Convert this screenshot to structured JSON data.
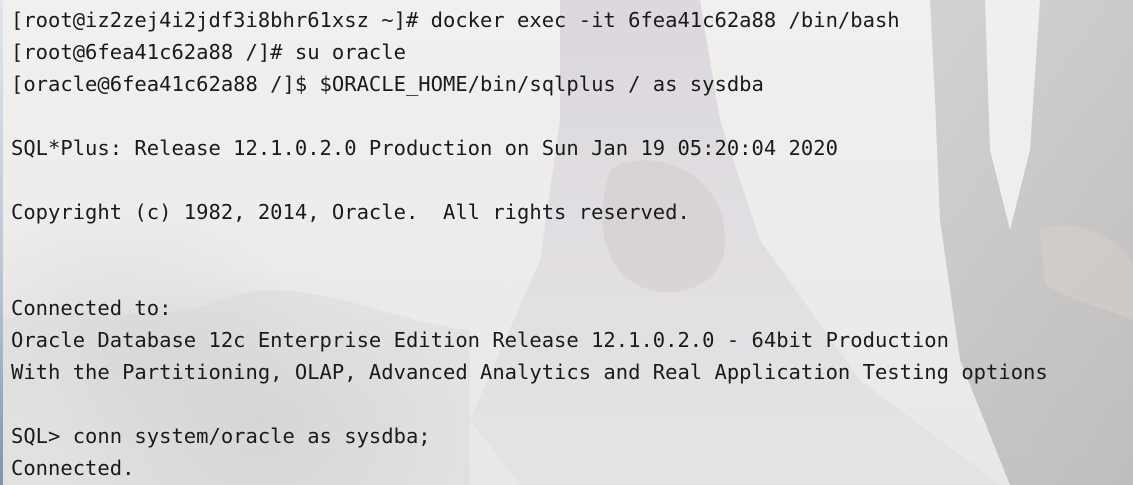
{
  "terminal": {
    "lines": [
      "[root@iz2zej4i2jdf3i8bhr61xsz ~]# docker exec -it 6fea41c62a88 /bin/bash",
      "[root@6fea41c62a88 /]# su oracle",
      "[oracle@6fea41c62a88 /]$ $ORACLE_HOME/bin/sqlplus / as sysdba",
      "",
      "SQL*Plus: Release 12.1.0.2.0 Production on Sun Jan 19 05:20:04 2020",
      "",
      "Copyright (c) 1982, 2014, Oracle.  All rights reserved.",
      "",
      "",
      "Connected to:",
      "Oracle Database 12c Enterprise Edition Release 12.1.0.2.0 - 64bit Production",
      "With the Partitioning, OLAP, Advanced Analytics and Real Application Testing options",
      "",
      "SQL> conn system/oracle as sysdba;",
      "Connected."
    ]
  },
  "colors": {
    "text": "#1a1a1a",
    "background": "#efeeed"
  }
}
